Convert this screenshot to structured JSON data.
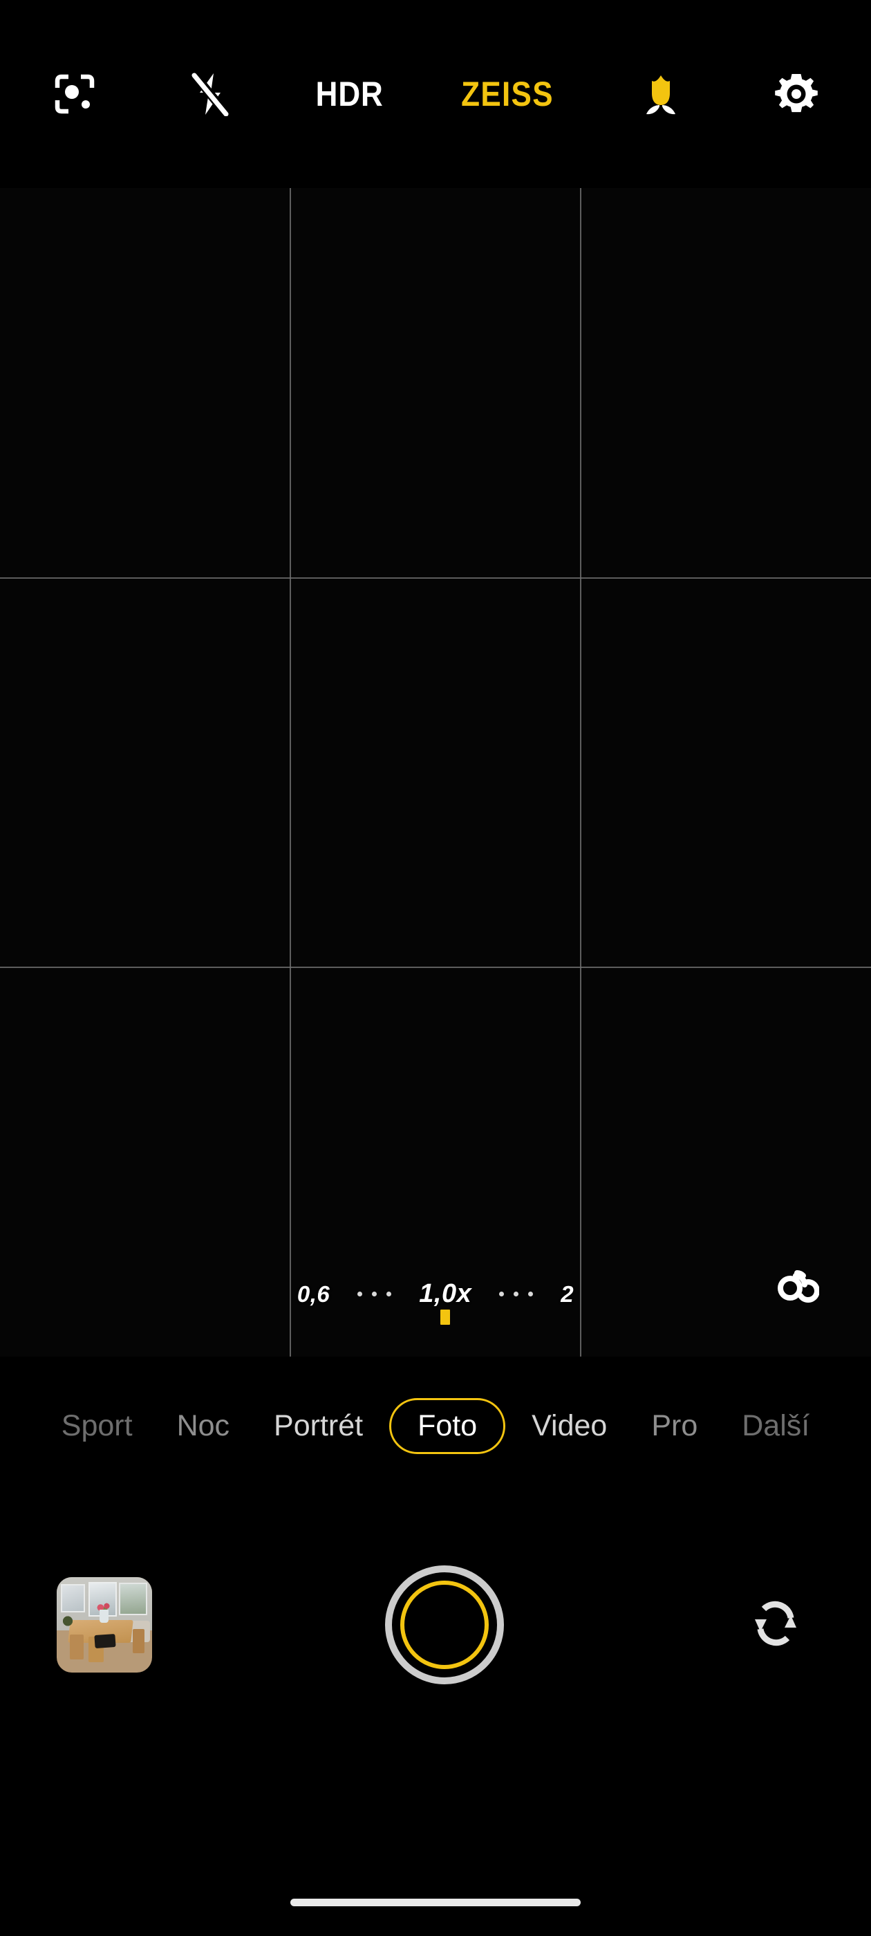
{
  "app": {
    "name": "Camera",
    "accent_color": "#f3c410",
    "background_color": "#000000"
  },
  "top_bar": {
    "items": [
      {
        "name": "ai-scene-detection",
        "icon": "ai-scene-icon",
        "label": "",
        "state": "off"
      },
      {
        "name": "flash",
        "icon": "flash-off-icon",
        "label": "",
        "state": "off"
      },
      {
        "name": "hdr",
        "icon": "hdr-text",
        "label": "HDR",
        "state": "on",
        "color": "#ffffff"
      },
      {
        "name": "zeiss",
        "icon": "zeiss-text",
        "label": "ZEISS",
        "state": "on",
        "color": "#f3c410"
      },
      {
        "name": "macro",
        "icon": "tulip-icon",
        "label": "",
        "state": "on",
        "color": "#f3c410"
      },
      {
        "name": "settings",
        "icon": "gear-icon",
        "label": "",
        "state": "off"
      }
    ]
  },
  "viewfinder": {
    "grid": "rule-of-thirds",
    "grid_color": "#6d6d6d",
    "grid_visible": true,
    "preview_color": "#050505",
    "lens_switch_icon": "camera-lenses-icon"
  },
  "zoom": {
    "current": "1,0x",
    "steps": [
      {
        "label": "0,6",
        "active": false
      },
      {
        "label": "1,0x",
        "active": true
      },
      {
        "label": "2",
        "active": false
      }
    ],
    "marker_color": "#f3c410"
  },
  "modes": {
    "selected": "Foto",
    "items": [
      {
        "label": "Sport",
        "active": false,
        "dim": "dim3"
      },
      {
        "label": "Noc",
        "active": false,
        "dim": "dim2"
      },
      {
        "label": "Portrét",
        "active": false,
        "dim": "dim1"
      },
      {
        "label": "Foto",
        "active": true,
        "dim": ""
      },
      {
        "label": "Video",
        "active": false,
        "dim": "dim1"
      },
      {
        "label": "Pro",
        "active": false,
        "dim": "dim2"
      },
      {
        "label": "Další",
        "active": false,
        "dim": "dim3"
      }
    ]
  },
  "bottom_bar": {
    "gallery": {
      "name": "gallery-thumbnail",
      "description": "dining room with wooden table, chairs, flowers and windows"
    },
    "shutter": {
      "name": "shutter-button",
      "outer_color": "#cccccc",
      "inner_color": "#f3c410"
    },
    "flip": {
      "name": "switch-camera-button",
      "icon": "camera-flip-icon"
    }
  },
  "system": {
    "home_indicator_color": "#e9e9e9"
  }
}
